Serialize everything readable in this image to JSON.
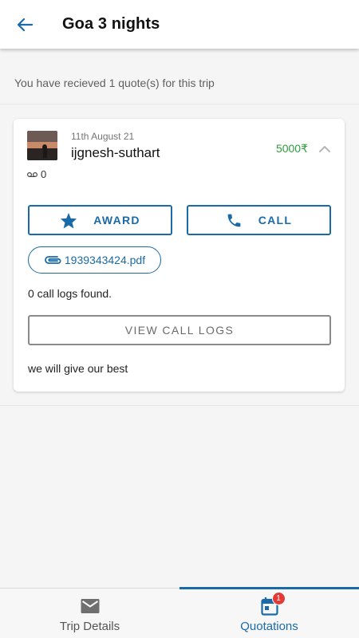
{
  "appbar": {
    "title": "Goa 3 nights",
    "back_icon": "arrow-left-icon"
  },
  "summary": {
    "text": "You have recieved 1 quote(s) for this trip"
  },
  "quote": {
    "date": "11th August 21",
    "name": "ijgnesh-suthart",
    "price": "5000₹",
    "voicemail_count": "0",
    "award_label": "AWARD",
    "call_label": "CALL",
    "attachment": "1939343424.pdf",
    "call_logs_text": "0 call logs found.",
    "view_logs_label": "VIEW CALL LOGS",
    "remark": "we will give our best"
  },
  "bottom_nav": {
    "items": [
      {
        "label": "Trip Details",
        "icon": "mail-icon",
        "active": false
      },
      {
        "label": "Quotations",
        "icon": "calendar-icon",
        "active": true,
        "badge": "1"
      }
    ]
  },
  "colors": {
    "accent": "#1a6aa8",
    "price": "#2e9e3c",
    "badge": "#e53935"
  }
}
